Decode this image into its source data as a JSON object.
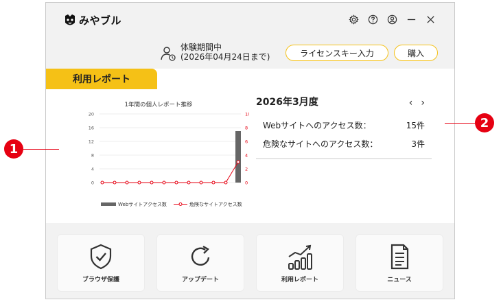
{
  "app": {
    "name": "みやブル"
  },
  "license": {
    "trial_label": "体験期間中",
    "trial_until": "(2026年04月24日まで)",
    "license_button": "ライセンスキー入力",
    "buy_button": "購入"
  },
  "report": {
    "tab_label": "利用レポート",
    "month_title": "2026年3月度",
    "prev": "‹",
    "next": "›",
    "rows": [
      {
        "label": "Webサイトへのアクセス数：",
        "value": "15件"
      },
      {
        "label": "危険なサイトへのアクセス数：",
        "value": "3件"
      }
    ]
  },
  "chart_data": {
    "type": "bar",
    "title": "1年間の個人レポート推移",
    "categories": [
      "",
      "",
      "",
      "",
      "",
      "",
      "",
      "",
      "",
      "",
      "",
      ""
    ],
    "series": [
      {
        "name": "Webサイトアクセス数",
        "type": "bar",
        "axis": "left",
        "color": "#666666",
        "values": [
          0,
          0,
          0,
          0,
          0,
          0,
          0,
          0,
          0,
          0,
          0,
          15
        ]
      },
      {
        "name": "危険なサイトアクセス数",
        "type": "line",
        "axis": "right",
        "color": "#e60012",
        "values": [
          0,
          0,
          0,
          0,
          0,
          0,
          0,
          0,
          0,
          0,
          0,
          3
        ]
      }
    ],
    "ylim": [
      0,
      20
    ],
    "y_ticks": [
      "0",
      "4",
      "8",
      "12",
      "16",
      "20"
    ],
    "y2lim": [
      0,
      10
    ],
    "y2_ticks": [
      "0",
      "2",
      "4",
      "6",
      "8",
      "10"
    ]
  },
  "tiles": [
    {
      "label": "ブラウザ保護",
      "icon": "shield-check-icon"
    },
    {
      "label": "アップデート",
      "icon": "refresh-icon"
    },
    {
      "label": "利用レポート",
      "icon": "bar-chart-icon"
    },
    {
      "label": "ニュース",
      "icon": "document-icon"
    }
  ],
  "callouts": [
    "1",
    "2"
  ],
  "colors": {
    "accent": "#f5c116",
    "callout": "#e60012"
  }
}
